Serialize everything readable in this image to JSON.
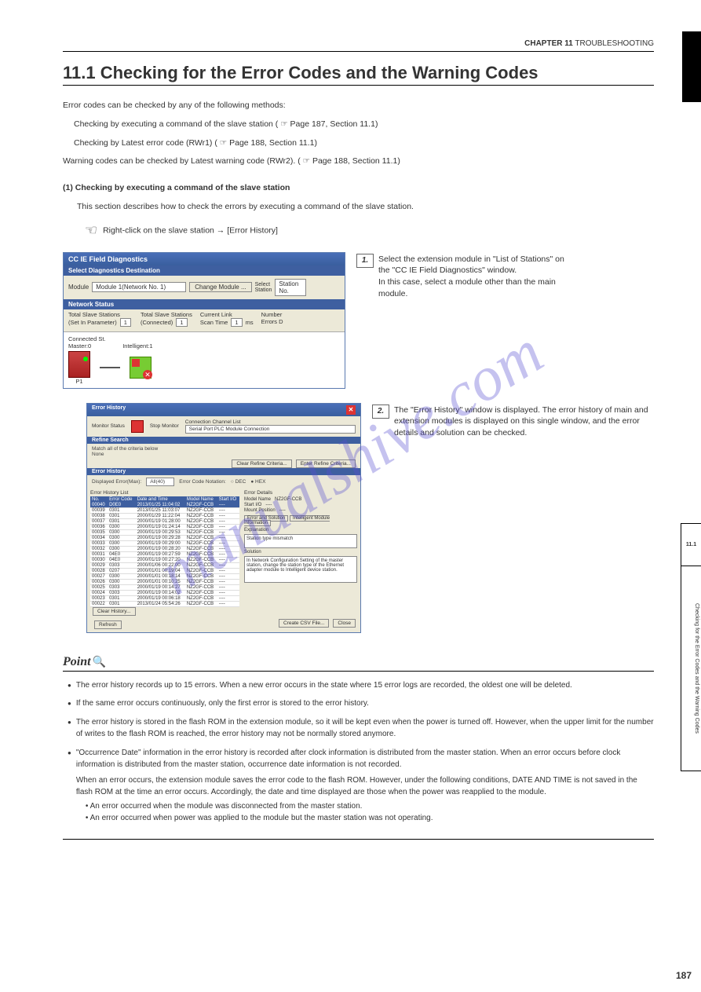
{
  "header": {
    "chapter": "CHAPTER 11",
    "chapter_title": "TROUBLESHOOTING"
  },
  "black_tab": "11",
  "section": {
    "number": "11.1",
    "title": "Checking for the Error Codes and the Warning Codes"
  },
  "intro": "Error codes can be checked by any of the following methods:",
  "bullets": [
    "Checking by executing a command of the slave station ( ☞ Page 187, Section 11.1)",
    "Checking by Latest error code (RWr1) ( ☞ Page 188, Section 11.1)"
  ],
  "warn": "Warning codes can be checked by Latest warning code (RWr2). ( ☞ Page 188, Section 11.1)",
  "sub": {
    "head": "(1) Checking by executing a command of the slave station",
    "text": "This section describes how to check the errors by executing a command of the slave station."
  },
  "navline": {
    "hand": "☞",
    "text": "Right-click on the slave station → [Error History]"
  },
  "step1": {
    "n": "1.",
    "text1a": "Select the extension module in \"List of Stations\" on",
    "text1b": "the \"CC IE Field Diagnostics\" window.",
    "text1c": "In this case, select a module other than the main",
    "text1d": "module."
  },
  "step2": {
    "n": "2.",
    "text2": "The \"Error History\" window is displayed. The error history of main and extension modules is displayed on this single window, and the error details and solution can be checked."
  },
  "shot1": {
    "title": "CC IE Field Diagnostics",
    "select_bar": "Select Diagnostics Destination",
    "module_lbl": "Module",
    "module_val": "Module 1(Network No. 1)",
    "change_btn": "Change Module ...",
    "select_station_lbl": "Select\nStation",
    "station_lbl": "Station No.",
    "network_bar": "Network Status",
    "total_set_lbl": "Total Slave Stations\n(Set In Parameter)",
    "total_set_val": "1",
    "total_conn_lbl": "Total Slave Stations\n(Connected)",
    "total_conn_val": "1",
    "link_lbl": "Current Link\nScan Time",
    "link_val": "1",
    "link_unit": "ms",
    "number_lbl": "Number\nErrors D",
    "connected": "Connected St.",
    "master": "Master:0",
    "p1": "P1",
    "intel": "Intelligent:1"
  },
  "shot2": {
    "title": "Error History",
    "monitor_status": "Monitor Status",
    "stop_monitor": "Stop Monitor",
    "conn_ch_lbl": "Connection Channel List",
    "conn_ch_val": "Serial Port  PLC Module Connection",
    "refine_bar": "Refine Search",
    "match_lbl": "Match all of the criteria below",
    "none": "None",
    "clear_refine_btn": "Clear Refine Criteria...",
    "enter_refine_btn": "Enter Refine Criteria...",
    "errhist_bar": "Error History",
    "errhist_list_lbl": "Error History List",
    "displayed_lbl": "Displayed Error(Max):",
    "displayed_val": "All(40)",
    "notation_lbl": "Error Code Notation:",
    "dec": "DEC",
    "hex": "HEX",
    "error_details_lbl": "Error Details",
    "model_lbl": "Model Name",
    "model_val": "NZ2GF-CCB",
    "start_lbl": "Start I/O",
    "start_val": "----",
    "mount_lbl": "Mount Position",
    "mount_val": "----",
    "err_sol_lbl": "Error and Solution",
    "intel_info": "Intelligent Module Information",
    "expl_lbl": "Explanation",
    "expl_val": "Station type mismatch",
    "sol_lbl": "Solution",
    "sol_val": "In Network Configuration Setting of the master station, change the station type of the Ethernet adapter module to Intelligent device station.",
    "clear_hist": "Clear History...",
    "refresh": "Refresh",
    "csv": "Create CSV File...",
    "close": "Close",
    "cols": [
      "No.",
      "Error Code",
      "Date and Time",
      "Model Name",
      "Start I/O"
    ],
    "rows": [
      [
        "00040",
        "D0E0",
        "2013/01/25 11:04:02",
        "NZ2GF-CCB",
        "----"
      ],
      [
        "00039",
        "0301",
        "2013/01/25 11:03:07",
        "NZ2GF-CCB",
        "----"
      ],
      [
        "00038",
        "0301",
        "2000/01/29 11:22:04",
        "NZ2GF-CCB",
        "----"
      ],
      [
        "00037",
        "0301",
        "2000/01/19 01:28:00",
        "NZ2GF-CCB",
        "----"
      ],
      [
        "00036",
        "0300",
        "2000/01/19 01:24:14",
        "NZ2GF-CCB",
        "----"
      ],
      [
        "00035",
        "0300",
        "2000/01/19 00:29:53",
        "NZ2GF-CCB",
        "----"
      ],
      [
        "00034",
        "0300",
        "2000/01/19 00:29:28",
        "NZ2GF-CCB",
        "----"
      ],
      [
        "00033",
        "0300",
        "2000/01/19 00:29:00",
        "NZ2GF-CCB",
        "----"
      ],
      [
        "00032",
        "0300",
        "2000/01/19 00:28:20",
        "NZ2GF-CCB",
        "----"
      ],
      [
        "00031",
        "04E0",
        "2000/01/19 00:27:59",
        "NZ2GF-CCB",
        "----"
      ],
      [
        "00030",
        "04E0",
        "2000/01/19 00:27:20",
        "NZ2GF-CCB",
        "----"
      ],
      [
        "00029",
        "0303",
        "2000/01/06 00:22:00",
        "NZ2GF-CCB",
        "----"
      ],
      [
        "00028",
        "0207",
        "2000/01/01 00:19:04",
        "NZ2GF-CCB",
        "----"
      ],
      [
        "00027",
        "0300",
        "2000/01/01 00:18:14",
        "NZ2GF-CCB",
        "----"
      ],
      [
        "00026",
        "0300",
        "2000/01/01 00:10:25",
        "NZ2GF-CCB",
        "----"
      ],
      [
        "00025",
        "0303",
        "2000/01/19 00:14:27",
        "NZ2GF-CCB",
        "----"
      ],
      [
        "00024",
        "0303",
        "2000/01/19 00:14:02",
        "NZ2GF-CCB",
        "----"
      ],
      [
        "00023",
        "0301",
        "2000/01/19 00:06:18",
        "NZ2GF-CCB",
        "----"
      ],
      [
        "00022",
        "0301",
        "2013/01/24 05:54:26",
        "NZ2GF-CCB",
        "----"
      ]
    ]
  },
  "point": {
    "head": "Point",
    "p1": "The error history records up to 15 errors. When a new error occurs in the state where 15 error logs are recorded, the oldest one will be deleted.",
    "p2": "If the same error occurs continuously, only the first error is stored to the error history.",
    "p3": "The error history is stored in the flash ROM in the extension module, so it will be kept even when the power is turned off. However, when the upper limit for the number of writes to the flash ROM is reached, the error history may not be normally stored anymore.",
    "p4a": "\"Occurrence Date\" information in the error history is recorded after clock information is distributed from the master station. When an error occurs before clock information is distributed from the master station, occurrence date information is not recorded.",
    "p4b": "When an error occurs, the extension module saves the error code to the flash ROM. However, under the following conditions, DATE AND TIME is not saved in the flash ROM at the time an error occurs. Accordingly, the date and time displayed are those when the power was reapplied to the module.",
    "p4c1": "An error occurred when the module was disconnected from the master station.",
    "p4c2": "An error occurred when power was applied to the module but the master station was not operating."
  },
  "side_index": {
    "num": "11.1",
    "text": "Checking for the Error Codes and the Warning Codes"
  },
  "page_num": "187"
}
